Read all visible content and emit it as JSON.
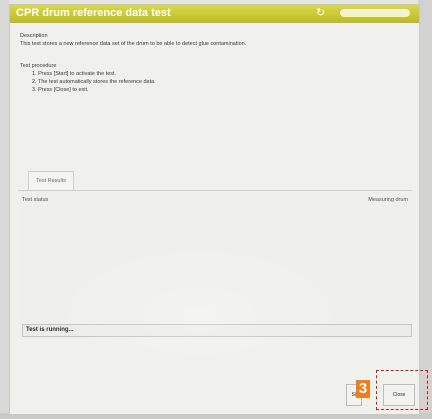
{
  "window": {
    "title": "CPR drum reference data test"
  },
  "description": {
    "heading": "Description",
    "text": "This test stores a new reference data set of the drum to be able to detect glue contamination."
  },
  "procedure": {
    "heading": "Test procedure",
    "steps": [
      "1. Press [Start] to activate the test.",
      "2. The test automatically stores the reference data.",
      "3. Press [Close] to exit."
    ]
  },
  "results": {
    "tab_label": "Test Results",
    "status_label": "Test status",
    "status_value": "Measuring drum"
  },
  "status_bar": {
    "text": "Test is running..."
  },
  "buttons": {
    "start_label": "St",
    "close_label": "Close"
  },
  "annotation": {
    "step_number": "3",
    "color": "#f07e1c",
    "box_color": "#d01818"
  },
  "colors": {
    "titlebar": "#c8c832",
    "window_bg": "#f0f0ec"
  }
}
